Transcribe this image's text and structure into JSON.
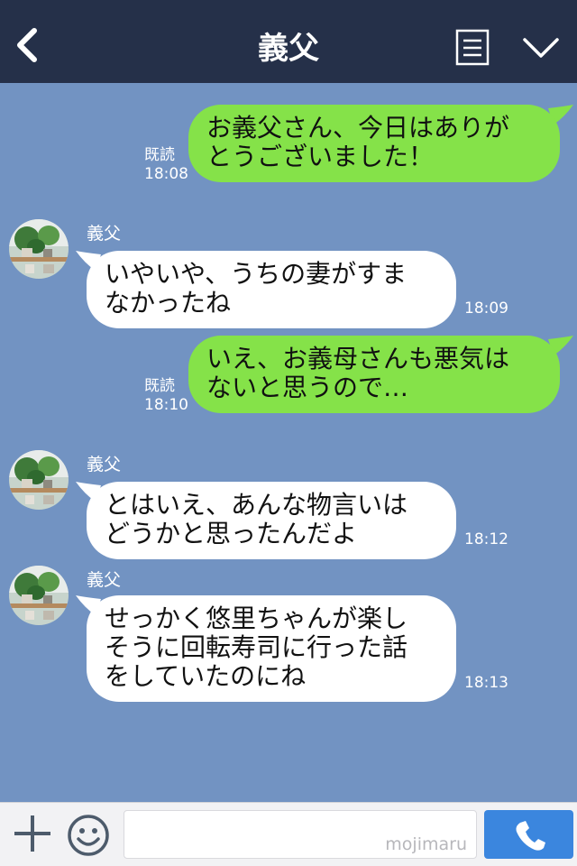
{
  "header": {
    "title": "義父",
    "back_icon": "chevron-left-icon",
    "notes_icon": "notes-icon",
    "menu_icon": "chevron-down-icon",
    "background": "#253049"
  },
  "chat": {
    "background": "#7293c2",
    "messages": [
      {
        "direction": "out",
        "text": "お義父さん、今日はありが\nとうございました！",
        "status": "既読",
        "time": "18:08"
      },
      {
        "direction": "in",
        "sender": "義父",
        "text": "いやいや、うちの妻がすま\nなかったね",
        "time": "18:09"
      },
      {
        "direction": "out",
        "text": "いえ、お義母さんも悪気は\nないと思うので…",
        "status": "既読",
        "time": "18:10"
      },
      {
        "direction": "in",
        "sender": "義父",
        "text": "とはいえ、あんな物言いは\nどうかと思ったんだよ",
        "time": "18:12"
      },
      {
        "direction": "in",
        "sender": "義父",
        "text": "せっかく悠里ちゃんが楽し\nそうに回転寿司に行った話\nをしていたのにね",
        "time": "18:13"
      }
    ]
  },
  "footer": {
    "plus_icon": "plus-icon",
    "emoji_icon": "smiley-icon",
    "input_value": "",
    "watermark": "mojimaru",
    "call_icon": "phone-icon",
    "call_color": "#3b86de"
  },
  "colors": {
    "outgoing_bubble": "#85e249",
    "incoming_bubble": "#ffffff"
  }
}
